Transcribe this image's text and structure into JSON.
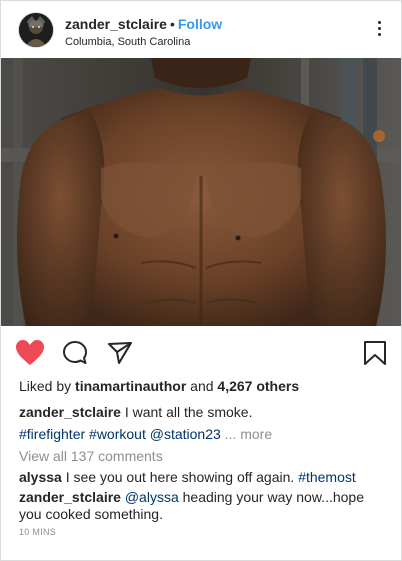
{
  "post": {
    "username": "zander_stclaire",
    "separator": "•",
    "follow_label": "Follow",
    "location": "Columbia, South Carolina",
    "liked_by_prefix": "Liked by ",
    "liked_by_user": "tinamartinauthor",
    "liked_by_and": " and ",
    "liked_by_others": "4,267 others",
    "caption": {
      "username": "zander_stclaire",
      "text": " I want all the smoke.",
      "tags": "#firefighter #workout @station23",
      "more": " ... more"
    },
    "view_all_comments": "View all 137 comments",
    "comments": [
      {
        "username": "alyssa",
        "text": " I see you out here showing off again. ",
        "tag": "#themost"
      },
      {
        "username": "zander_stclaire",
        "mention": " @alyssa",
        "text": " heading your way now...hope you cooked something."
      }
    ],
    "time_ago": "10 MINS"
  },
  "colors": {
    "accent_blue": "#3897f0",
    "like_red": "#ed4956",
    "hashtag_blue": "#003569",
    "muted_grey": "#8e8e8e"
  },
  "icons": {
    "more": "more-vertical-icon",
    "like": "heart-icon",
    "comment": "comment-bubble-icon",
    "share": "paper-plane-icon",
    "save": "bookmark-icon"
  }
}
